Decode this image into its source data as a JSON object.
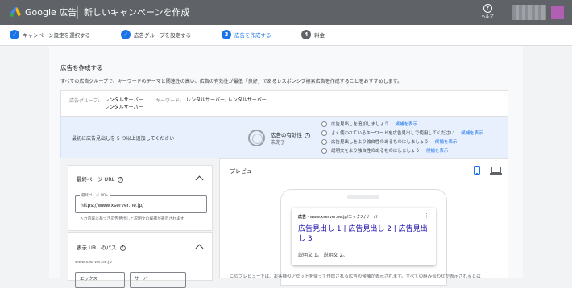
{
  "header": {
    "brand": "Google 広告",
    "page_title": "新しいキャンペーンを作成",
    "help_label": "ヘルプ",
    "logo_colors": [
      "#fbbc04",
      "#4285f4",
      "#34a853"
    ]
  },
  "steps": [
    {
      "num": "✓",
      "label": "キャンペーン設定を選択する",
      "state": "done"
    },
    {
      "num": "✓",
      "label": "広告グループを設定する",
      "state": "done"
    },
    {
      "num": "3",
      "label": "広告を作成する",
      "state": "current"
    },
    {
      "num": "4",
      "label": "料金",
      "state": "todo"
    }
  ],
  "section": {
    "title": "広告を作成する",
    "subtitle": "すべての広告グループで、キーワードのテーマと関連性の高い、広告の有効性が最低「良好」であるレスポンシブ検索広告を作成することをおすすめします。"
  },
  "keywords_row": {
    "group_label": "広告グループ:",
    "group_value_1": "レンタルサーバー",
    "group_value_2": "レンタルサーバー",
    "kw_label": "キーワード:",
    "kw_value": "レンタルサーバー, レンタルサーバー"
  },
  "effectiveness": {
    "message": "最初に広告見出しを 5 つ以上追加してください",
    "label": "広告の有効性",
    "status": "未完了",
    "tips": [
      {
        "text": "広告見出しを追加しましょう",
        "link": "候補を表示"
      },
      {
        "text": "よく使われているキーワードを広告見出しで使用してください",
        "link": "候補を表示"
      },
      {
        "text": "広告見出しをより独自性のあるものにしましょう",
        "link": "候補を表示"
      },
      {
        "text": "説明文をより独自性のあるものにしましょう",
        "link": "候補を表示"
      }
    ]
  },
  "final_url": {
    "header": "最終ページ URL",
    "field_label": "最終ページ URL",
    "value": "https://www.xserver.ne.jp/",
    "hint": "入力内容に基づき広告見出しと説明文の候補が表示されます"
  },
  "display_path": {
    "header": "表示 URL のパス",
    "domain": "www.xserver.ne.jp",
    "path1": "エックス",
    "path2": "サーバー"
  },
  "preview": {
    "header": "プレビュー",
    "ad_badge": "広告",
    "ad_url": "· www.xserver.ne.jp/エックス/サーバー",
    "ad_title": "広告見出し 1 | 広告見出し 2 | 広告見出し 3",
    "ad_desc": "説明文 1。 説明文 2。",
    "note": "このプレビューでは、お客様のアセットを使って作成される広告の候補が表示されます。すべての組み合わせが表示されるとは"
  }
}
